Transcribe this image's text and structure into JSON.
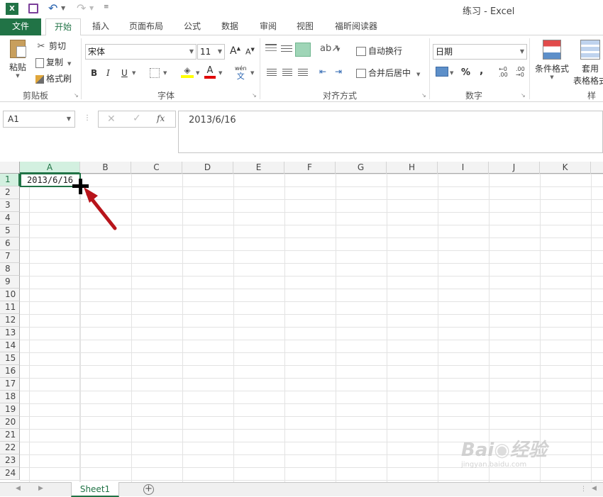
{
  "title_bar": {
    "window_title": "练习 - Excel",
    "colors": {
      "app_green": "#217346",
      "save_purple": "#7b3f9a"
    }
  },
  "ribbon_tabs": [
    "文件",
    "开始",
    "插入",
    "页面布局",
    "公式",
    "数据",
    "审阅",
    "视图",
    "福昕阅读器"
  ],
  "clipboard": {
    "paste": "粘贴",
    "cut": "剪切",
    "copy": "复制",
    "format_painter": "格式刷",
    "group": "剪贴板"
  },
  "font": {
    "name": "宋体",
    "size": "11",
    "bold": "B",
    "italic": "I",
    "underline": "U",
    "font_color_letter": "A",
    "phonetic": "wén",
    "phonetic_char": "文",
    "group": "字体"
  },
  "alignment": {
    "wrap_text": "自动换行",
    "merge_center": "合并后居中",
    "group": "对齐方式"
  },
  "number": {
    "format": "日期",
    "percent": "%",
    "comma": ",",
    "group": "数字"
  },
  "styles": {
    "conditional": "条件格式",
    "table_line1": "套用",
    "table_line2": "表格格式",
    "group": "样式"
  },
  "formula_bar": {
    "name_box": "A1",
    "fx": "fx",
    "value": "2013/6/16"
  },
  "columns": [
    "A",
    "B",
    "C",
    "D",
    "E",
    "F",
    "G",
    "H",
    "I",
    "J",
    "K"
  ],
  "rows": [
    "1",
    "2",
    "3",
    "4",
    "5",
    "6",
    "7",
    "8",
    "9",
    "10",
    "11",
    "12",
    "13",
    "14",
    "15",
    "16",
    "17",
    "18",
    "19",
    "20",
    "21",
    "22",
    "23",
    "24"
  ],
  "cells": {
    "A1": "2013/6/16"
  },
  "sheets": [
    "Sheet1"
  ]
}
